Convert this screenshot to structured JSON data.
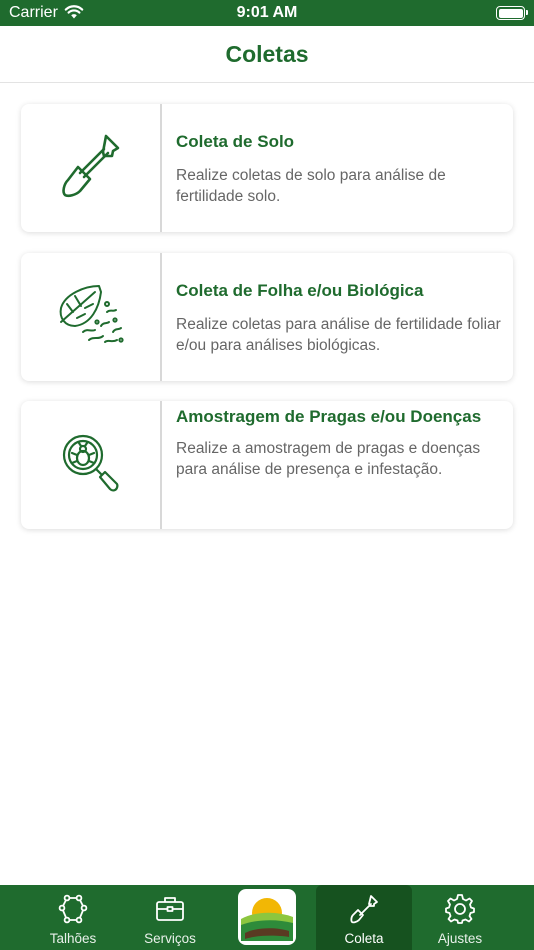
{
  "status_bar": {
    "carrier": "Carrier",
    "time": "9:01 AM"
  },
  "header": {
    "title": "Coletas"
  },
  "cards": [
    {
      "icon": "shovel-icon",
      "title": "Coleta de Solo",
      "description": "Realize coletas de solo para análise de fertilidade solo."
    },
    {
      "icon": "leaf-icon",
      "title": "Coleta de Folha e/ou Biológica",
      "description": "Realize coletas para análise de fertilidade foliar e/ou para análises biológicas."
    },
    {
      "icon": "magnifier-bug-icon",
      "title": "Amostragem de Pragas e/ou Doenças",
      "description": "Realize a amostragem de pragas e doenças para análise de presença e infestação."
    }
  ],
  "tabs": [
    {
      "label": "Talhões",
      "icon": "field-polygon-icon"
    },
    {
      "label": "Serviços",
      "icon": "briefcase-icon"
    },
    {
      "label": "",
      "icon": "app-logo"
    },
    {
      "label": "Coleta",
      "icon": "shovel-icon",
      "active": true
    },
    {
      "label": "Ajustes",
      "icon": "gear-icon"
    }
  ],
  "colors": {
    "brand_green": "#1f6b2e",
    "active_tab": "#16521f",
    "description_gray": "#666666"
  }
}
